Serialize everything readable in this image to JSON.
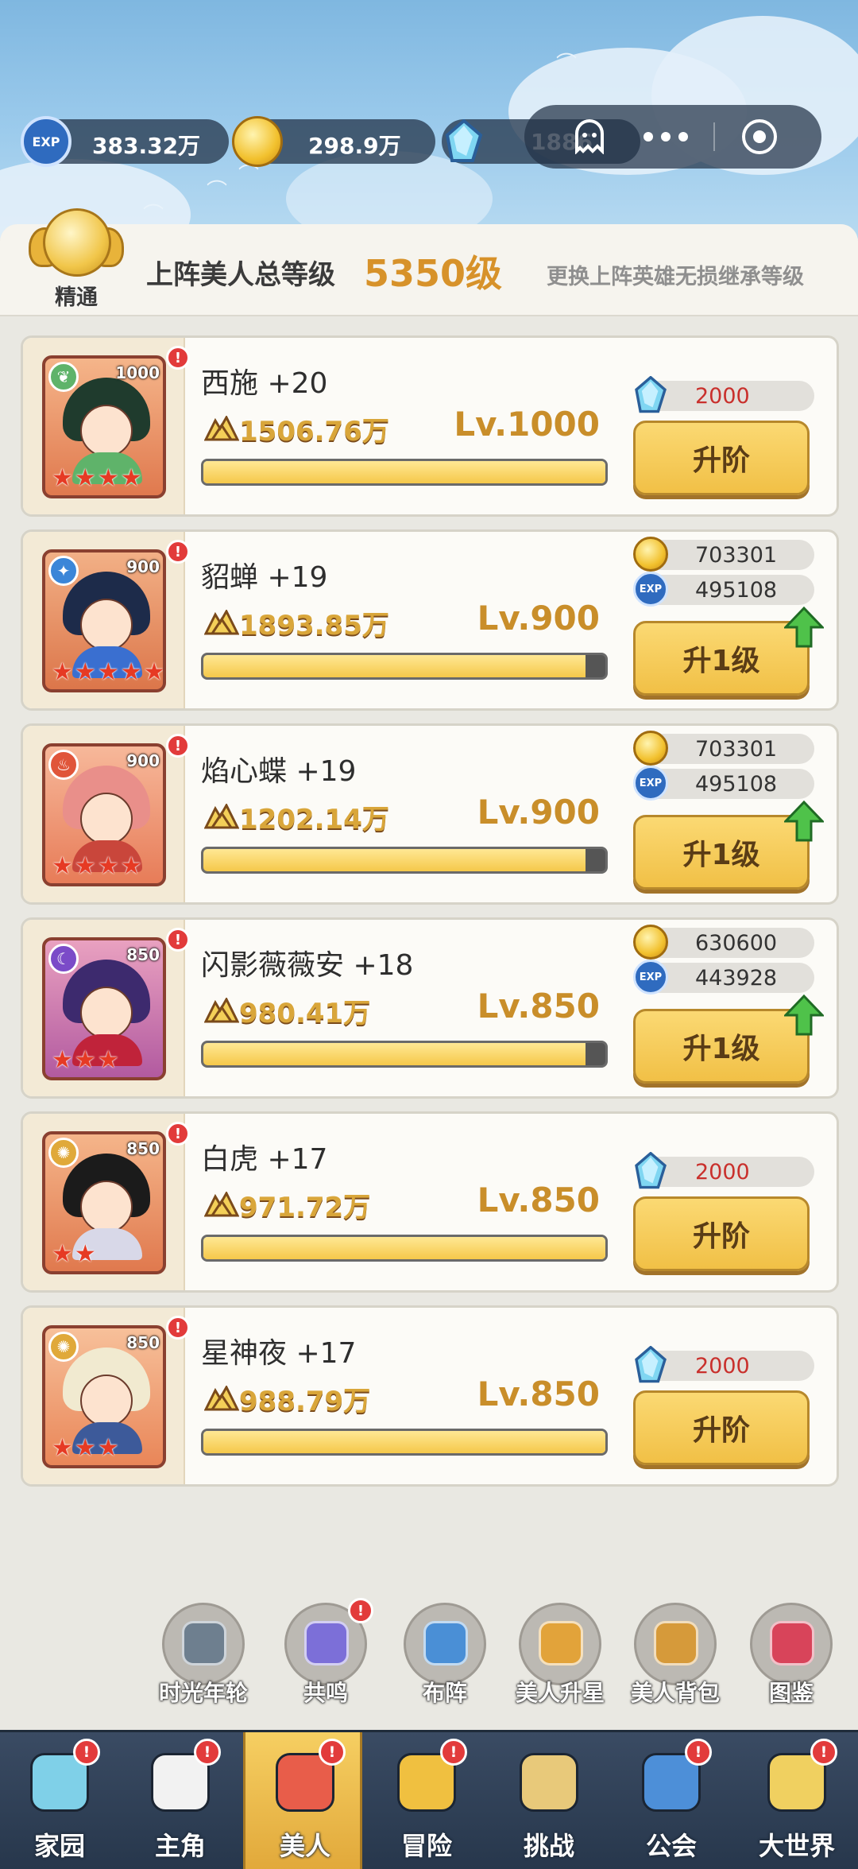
{
  "resources": {
    "exp": {
      "icon": "exp-icon",
      "label": "EXP",
      "value": "383.32万"
    },
    "gold": {
      "icon": "gold-coin-icon",
      "value": "298.9万"
    },
    "gem": {
      "icon": "blue-crystal-icon",
      "value": "1886"
    }
  },
  "capsule": {
    "ghost_icon": "ghost-icon",
    "more_icon": "more-dots-icon",
    "record_icon": "record-icon"
  },
  "summary": {
    "medal_label": "精通",
    "title": "上阵美人总等级",
    "value": "5350级",
    "note": "更换上阵英雄无损继承等级"
  },
  "heroes": [
    {
      "name": "西施 +20",
      "card_level": "1000",
      "stars": 4,
      "power": "1506.76万",
      "level": "Lv.1000",
      "progress": 1.0,
      "costs": [
        {
          "icon": "blue-crystal-icon",
          "value": "2000",
          "insufficient": true
        }
      ],
      "action": "升阶",
      "upgrade_hint": false
    },
    {
      "name": "貂蝉 +19",
      "card_level": "900",
      "stars": 5,
      "power": "1893.85万",
      "level": "Lv.900",
      "progress": 0.95,
      "costs": [
        {
          "icon": "gold-coin-icon",
          "label": "",
          "value": "703301"
        },
        {
          "icon": "exp-icon",
          "label": "EXP",
          "value": "495108"
        }
      ],
      "action": "升1级",
      "upgrade_hint": true
    },
    {
      "name": "焰心蝶 +19",
      "card_level": "900",
      "stars": 4,
      "power": "1202.14万",
      "level": "Lv.900",
      "progress": 0.95,
      "costs": [
        {
          "icon": "gold-coin-icon",
          "label": "",
          "value": "703301"
        },
        {
          "icon": "exp-icon",
          "label": "EXP",
          "value": "495108"
        }
      ],
      "action": "升1级",
      "upgrade_hint": true
    },
    {
      "name": "闪影薇薇安 +18",
      "card_level": "850",
      "stars": 3,
      "power": "980.41万",
      "level": "Lv.850",
      "progress": 0.95,
      "costs": [
        {
          "icon": "gold-coin-icon",
          "label": "",
          "value": "630600"
        },
        {
          "icon": "exp-icon",
          "label": "EXP",
          "value": "443928"
        }
      ],
      "action": "升1级",
      "upgrade_hint": true
    },
    {
      "name": "白虎 +17",
      "card_level": "850",
      "stars": 2,
      "power": "971.72万",
      "level": "Lv.850",
      "progress": 1.0,
      "costs": [
        {
          "icon": "blue-crystal-icon",
          "value": "2000",
          "insufficient": true
        }
      ],
      "action": "升阶",
      "upgrade_hint": false
    },
    {
      "name": "星神夜 +17",
      "card_level": "850",
      "stars": 3,
      "power": "988.79万",
      "level": "Lv.850",
      "progress": 1.0,
      "costs": [
        {
          "icon": "blue-crystal-icon",
          "value": "2000",
          "insufficient": true
        }
      ],
      "action": "升阶",
      "upgrade_hint": false
    }
  ],
  "shortcuts": [
    {
      "label": "时光年轮",
      "icon": "time-wheel-icon",
      "alert": false
    },
    {
      "label": "共鸣",
      "icon": "resonance-icon",
      "alert": true
    },
    {
      "label": "布阵",
      "icon": "formation-icon",
      "alert": false
    },
    {
      "label": "美人升星",
      "icon": "star-up-icon",
      "alert": false
    },
    {
      "label": "美人背包",
      "icon": "backpack-icon",
      "alert": false
    },
    {
      "label": "图鉴",
      "icon": "codex-icon",
      "alert": false
    }
  ],
  "nav": [
    {
      "label": "家园",
      "icon": "home-icon",
      "alert": true,
      "active": false
    },
    {
      "label": "主角",
      "icon": "protagonist-icon",
      "alert": true,
      "active": false
    },
    {
      "label": "美人",
      "icon": "beauties-icon",
      "alert": true,
      "active": true
    },
    {
      "label": "冒险",
      "icon": "adventure-icon",
      "alert": true,
      "active": false
    },
    {
      "label": "挑战",
      "icon": "challenge-icon",
      "alert": false,
      "active": false
    },
    {
      "label": "公会",
      "icon": "guild-icon",
      "alert": true,
      "active": false
    },
    {
      "label": "大世界",
      "icon": "world-icon",
      "alert": true,
      "active": false
    }
  ],
  "alert_mark": "!",
  "colors": {
    "accent_gold": "#f1c046",
    "level_text": "#c98e2a",
    "alert_red": "#e23b3b",
    "cost_insufficient": "#c9302c"
  }
}
